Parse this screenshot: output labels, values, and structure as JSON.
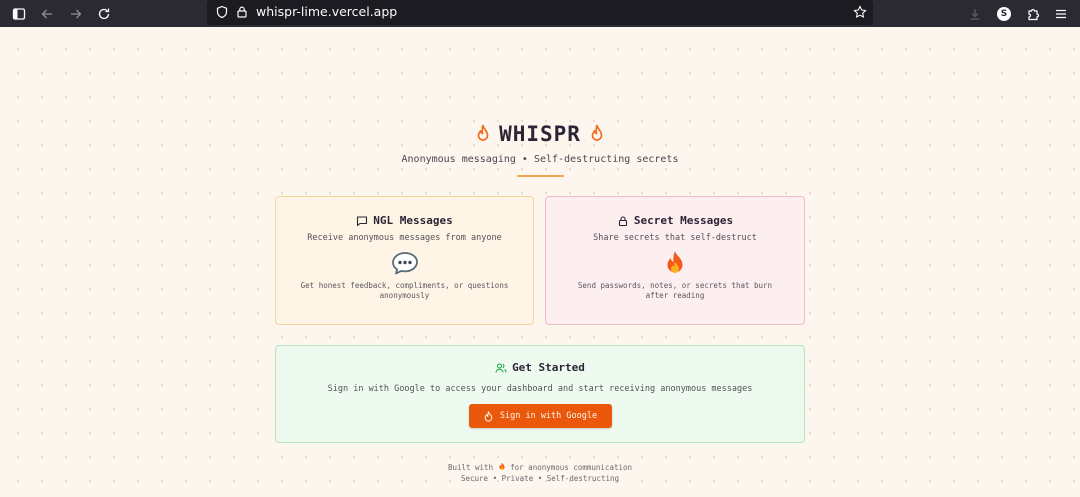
{
  "browser": {
    "url": "whispr-lime.vercel.app",
    "profile_initial": "S"
  },
  "hero": {
    "title": "WHISPR",
    "subtitle": "Anonymous messaging • Self-destructing secrets"
  },
  "cards": {
    "ngl": {
      "title": "NGL Messages",
      "description": "Receive anonymous messages from anyone",
      "note": "Get honest feedback, compliments, or questions anonymously"
    },
    "secret": {
      "title": "Secret Messages",
      "description": "Share secrets that self-destruct",
      "note": "Send passwords, notes, or secrets that burn after reading"
    },
    "start": {
      "title": "Get Started",
      "description": "Sign in with Google to access your dashboard and start receiving anonymous messages",
      "button_label": "Sign in with Google"
    }
  },
  "footer": {
    "line1_prefix": "Built with",
    "line1_suffix": "for anonymous communication",
    "line2": "Secure • Private • Self-destructing"
  },
  "colors": {
    "accent": "#ea580c",
    "flame": "#f26b1d",
    "ngl_bg": "#fef5e6",
    "secret_bg": "#fdeef0",
    "start_bg": "#eefaf0"
  }
}
